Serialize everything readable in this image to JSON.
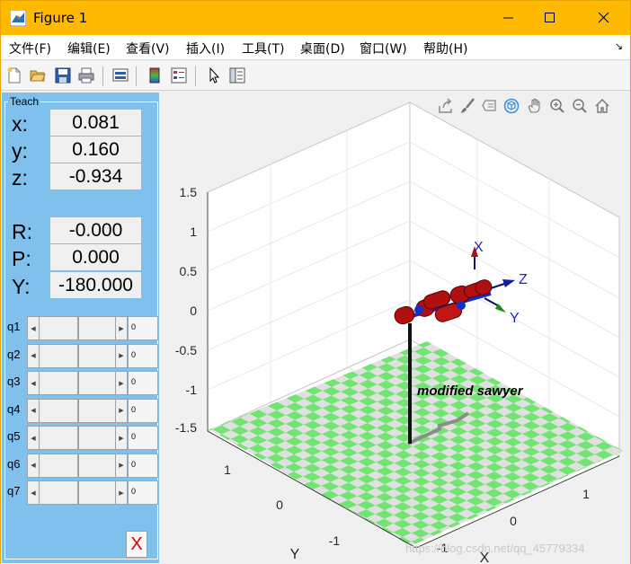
{
  "window": {
    "title": "Figure 1"
  },
  "menu": [
    "文件(F)",
    "编辑(E)",
    "查看(V)",
    "插入(I)",
    "工具(T)",
    "桌面(D)",
    "窗口(W)",
    "帮助(H)"
  ],
  "teach": {
    "title": "Teach",
    "pose": [
      {
        "label": "x:",
        "value": "0.081"
      },
      {
        "label": "y:",
        "value": "0.160"
      },
      {
        "label": "z:",
        "value": "-0.934"
      },
      {
        "label": "R:",
        "value": "-0.000"
      },
      {
        "label": "P:",
        "value": "0.000"
      },
      {
        "label": "Y:",
        "value": "-180.000"
      }
    ],
    "joints": [
      {
        "label": "q1",
        "value": "0"
      },
      {
        "label": "q2",
        "value": "0"
      },
      {
        "label": "q3",
        "value": "0"
      },
      {
        "label": "q4",
        "value": "0"
      },
      {
        "label": "q5",
        "value": "0"
      },
      {
        "label": "q6",
        "value": "0"
      },
      {
        "label": "q7",
        "value": "0"
      }
    ],
    "close_label": "X"
  },
  "plot": {
    "z_ticks": [
      "1.5",
      "1",
      "0.5",
      "0",
      "-0.5",
      "-1",
      "-1.5"
    ],
    "y_ticks": [
      "1",
      "0",
      "-1"
    ],
    "x_ticks": [
      "1",
      "0",
      "-1"
    ],
    "y_label": "Y",
    "x_label": "X",
    "robot_name": "modified sawyer",
    "frame_labels": {
      "x": "X",
      "y": "Y",
      "z": "Z"
    },
    "watermark": "https://blog.csdn.net/qq_45779334"
  },
  "colors": {
    "title_bar": "#ffb900",
    "teach_panel": "#7fc1ec",
    "floor_green": "#72e472",
    "floor_gray": "#e0e0e0",
    "link_red": "#b01010",
    "joint_blue": "#1030c8",
    "x_button": "#e00000"
  }
}
